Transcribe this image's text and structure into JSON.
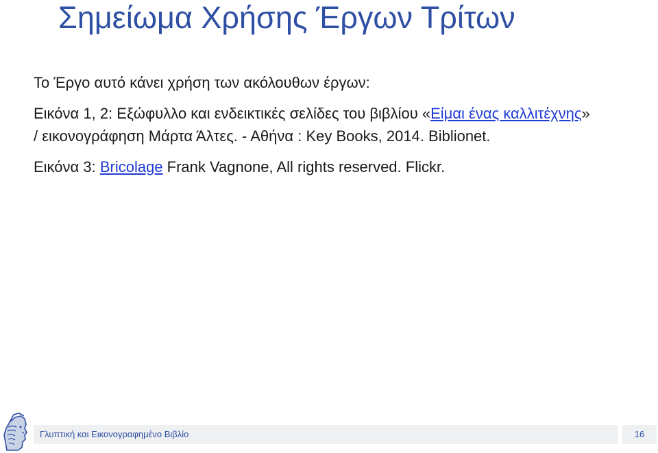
{
  "slide": {
    "title": "Σημείωμα Χρήσης Έργων Τρίτων",
    "intro": "Το Έργο αυτό κάνει χρήση των ακόλουθων έργων:",
    "credit1": {
      "prefix": "Εικόνα 1, 2: Εξώφυλλο και ενδεικτικές σελίδες του βιβλίου «",
      "link_text": "Είμαι ένας καλλιτέχνης",
      "suffix": "» / εικονογράφηση Μάρτα Άλτες. - Αθήνα : Key Books, 2014. Biblionet."
    },
    "credit2": {
      "prefix": "Εικόνα 3: ",
      "link_text": "Bricolage",
      "suffix": " Frank Vagnone, All rights reserved. Flickr."
    }
  },
  "footer": {
    "text": "Γλυπτική και Εικονογραφημένο Βιβλίο",
    "page_number": "16",
    "logo_icon": "athena-head-logo-icon"
  },
  "colors": {
    "title": "#2e4fa3",
    "link": "#1f3bd6",
    "footer_bar": "#eef0f2",
    "body_text": "#1a1a1a"
  }
}
